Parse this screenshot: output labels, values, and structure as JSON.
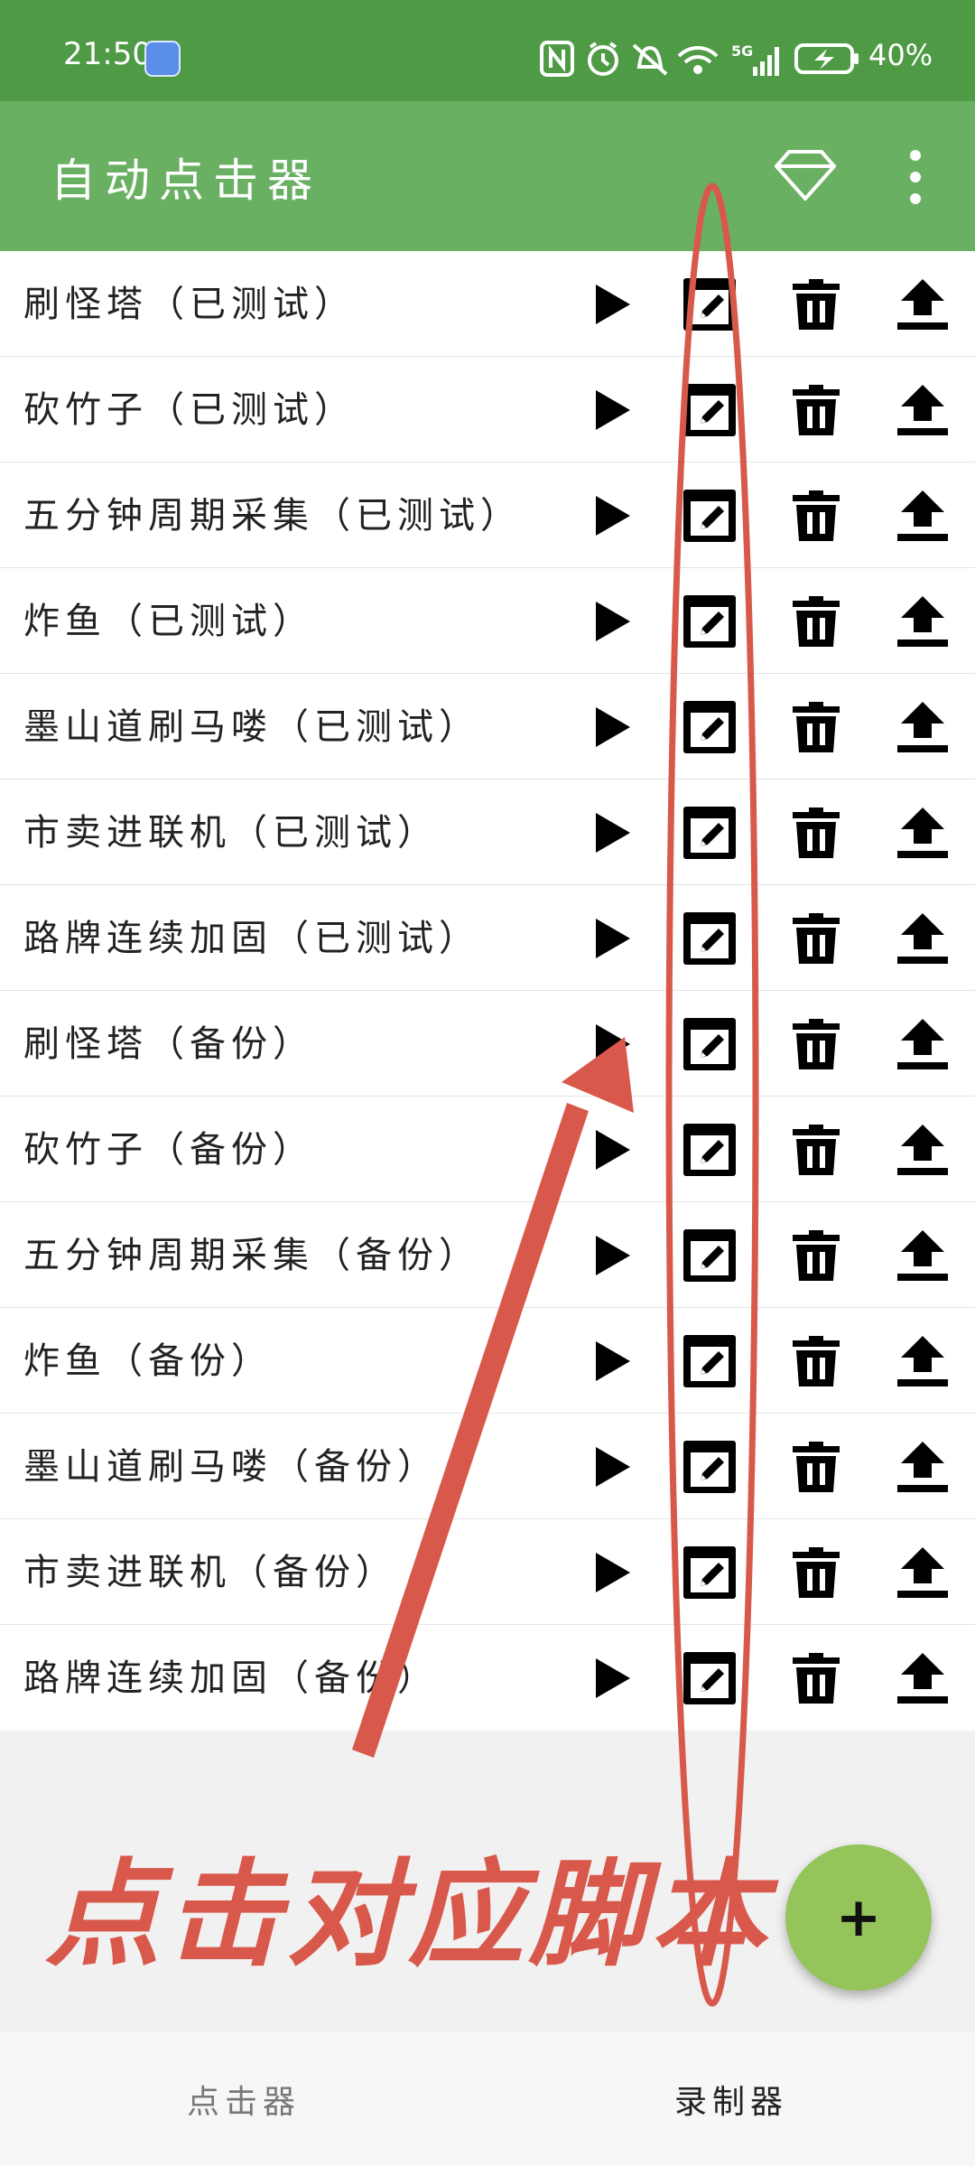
{
  "status_bar": {
    "time": "21:50",
    "battery": "40%",
    "icons": [
      "nfc-icon",
      "alarm-icon",
      "mute-icon",
      "wifi-icon",
      "signal-5g-icon",
      "battery-charging-icon"
    ]
  },
  "app_bar": {
    "title": "自动点击器",
    "icons": [
      "diamond-icon",
      "more-vert-icon"
    ]
  },
  "scripts": [
    {
      "name": "刷怪塔（已测试）"
    },
    {
      "name": "砍竹子（已测试）"
    },
    {
      "name": "五分钟周期采集（已测试）"
    },
    {
      "name": "炸鱼（已测试）"
    },
    {
      "name": "墨山道刷马喽（已测试）"
    },
    {
      "name": "市卖进联机（已测试）"
    },
    {
      "name": "路牌连续加固（已测试）"
    },
    {
      "name": "刷怪塔（备份）"
    },
    {
      "name": "砍竹子（备份）"
    },
    {
      "name": "五分钟周期采集（备份）"
    },
    {
      "name": "炸鱼（备份）"
    },
    {
      "name": "墨山道刷马喽（备份）"
    },
    {
      "name": "市卖进联机（备份）"
    },
    {
      "name": "路牌连续加固（备份）"
    }
  ],
  "row_actions": [
    "play-icon",
    "edit-icon",
    "delete-icon",
    "upload-icon"
  ],
  "annotation": {
    "text": "点击对应脚本",
    "color": "#d8594b"
  },
  "fab": {
    "label": "+"
  },
  "bottom_nav": {
    "tabs": [
      {
        "label": "点击器",
        "active": false
      },
      {
        "label": "录制器",
        "active": true
      }
    ]
  },
  "colors": {
    "status_bar": "#4e9a45",
    "app_bar": "#6ab062",
    "fab": "#94c45a",
    "annotation": "#d8594b"
  }
}
